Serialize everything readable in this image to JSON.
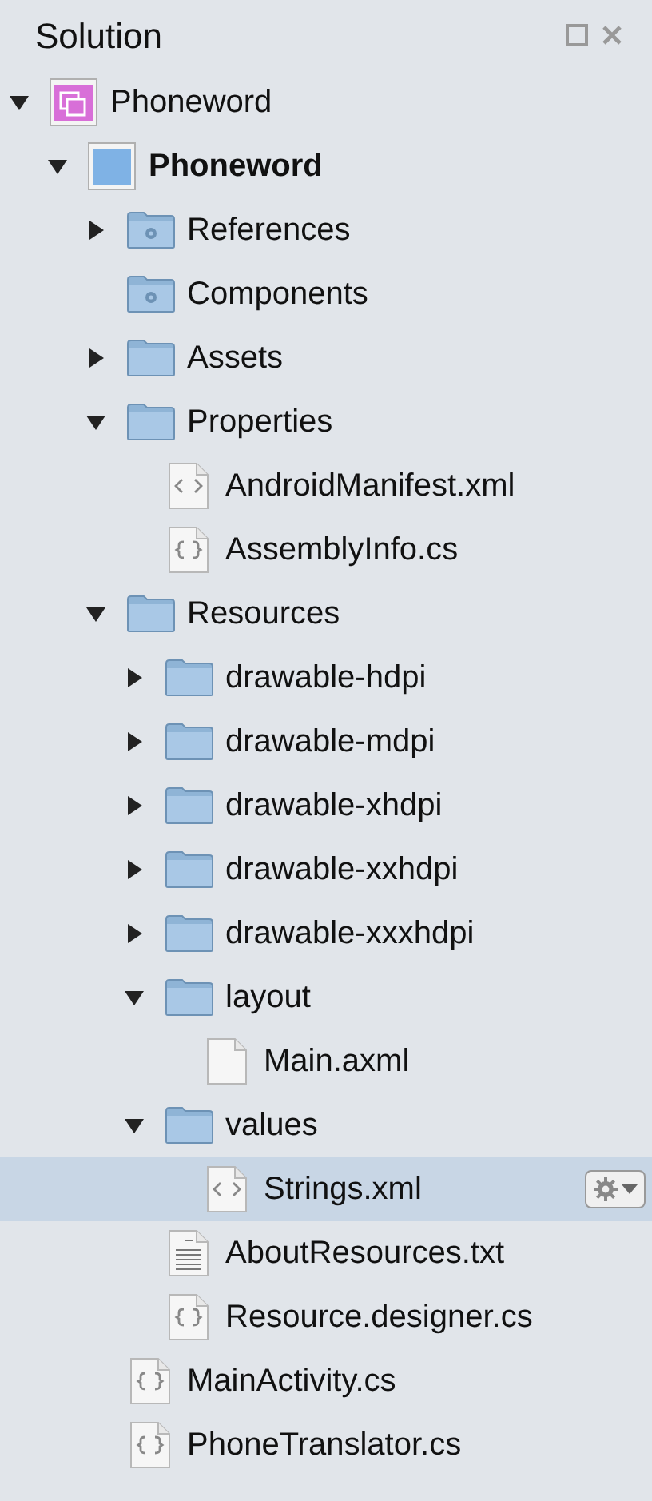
{
  "panel": {
    "title": "Solution"
  },
  "tree": [
    {
      "kind": "solution",
      "label": "Phoneword",
      "expanded": true,
      "selected": false,
      "children": [
        {
          "kind": "project",
          "label": "Phoneword",
          "expanded": true,
          "selected": false,
          "children": [
            {
              "kind": "folder-gear",
              "label": "References",
              "expanded": false,
              "selected": false
            },
            {
              "kind": "folder-gear",
              "label": "Components",
              "selected": false
            },
            {
              "kind": "folder",
              "label": "Assets",
              "expanded": false,
              "selected": false
            },
            {
              "kind": "folder",
              "label": "Properties",
              "expanded": true,
              "selected": false,
              "children": [
                {
                  "kind": "xml",
                  "label": "AndroidManifest.xml",
                  "selected": false
                },
                {
                  "kind": "cs",
                  "label": "AssemblyInfo.cs",
                  "selected": false
                }
              ]
            },
            {
              "kind": "folder",
              "label": "Resources",
              "expanded": true,
              "selected": false,
              "children": [
                {
                  "kind": "folder",
                  "label": "drawable-hdpi",
                  "expanded": false,
                  "selected": false
                },
                {
                  "kind": "folder",
                  "label": "drawable-mdpi",
                  "expanded": false,
                  "selected": false
                },
                {
                  "kind": "folder",
                  "label": "drawable-xhdpi",
                  "expanded": false,
                  "selected": false
                },
                {
                  "kind": "folder",
                  "label": "drawable-xxhdpi",
                  "expanded": false,
                  "selected": false
                },
                {
                  "kind": "folder",
                  "label": "drawable-xxxhdpi",
                  "expanded": false,
                  "selected": false
                },
                {
                  "kind": "folder",
                  "label": "layout",
                  "expanded": true,
                  "selected": false,
                  "children": [
                    {
                      "kind": "file",
                      "label": "Main.axml",
                      "selected": false
                    }
                  ]
                },
                {
                  "kind": "folder",
                  "label": "values",
                  "expanded": true,
                  "selected": false,
                  "children": [
                    {
                      "kind": "xml",
                      "label": "Strings.xml",
                      "selected": true
                    }
                  ]
                },
                {
                  "kind": "text",
                  "label": "AboutResources.txt",
                  "selected": false
                },
                {
                  "kind": "cs",
                  "label": "Resource.designer.cs",
                  "selected": false
                }
              ]
            },
            {
              "kind": "cs",
              "label": "MainActivity.cs",
              "selected": false
            },
            {
              "kind": "cs",
              "label": "PhoneTranslator.cs",
              "selected": false
            }
          ]
        }
      ]
    }
  ]
}
